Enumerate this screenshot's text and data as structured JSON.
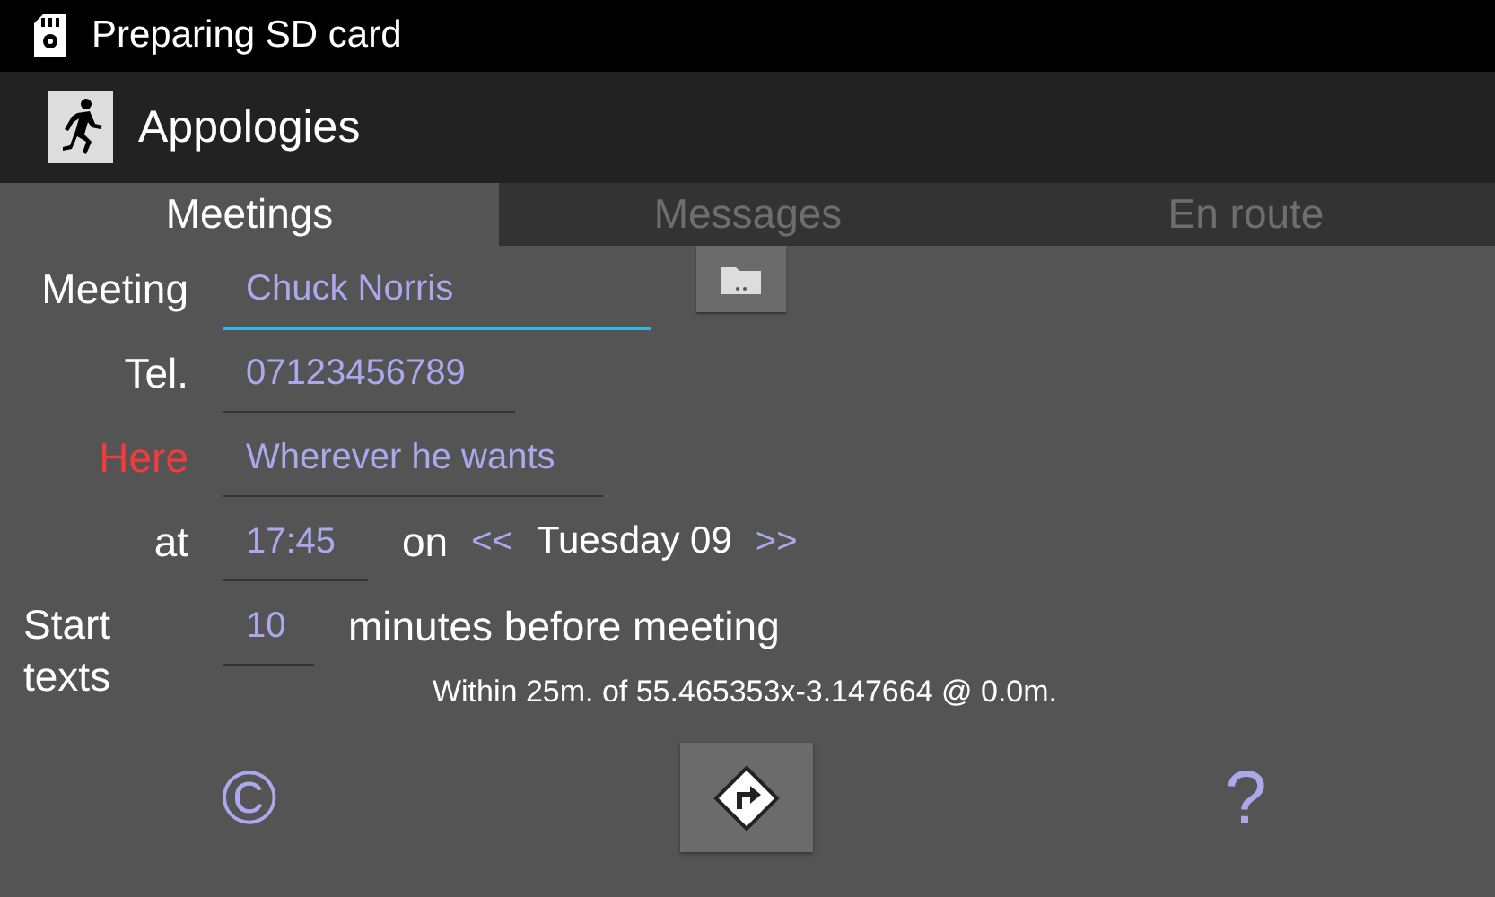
{
  "status_bar": {
    "notification": "Preparing SD card"
  },
  "action_bar": {
    "title": "Appologies"
  },
  "tabs": [
    {
      "label": "Meetings",
      "selected": true
    },
    {
      "label": "Messages",
      "selected": false
    },
    {
      "label": "En route",
      "selected": false
    }
  ],
  "form": {
    "meeting": {
      "label": "Meeting",
      "value": "Chuck Norris",
      "focused": true
    },
    "tel": {
      "label": "Tel.",
      "value": "07123456789",
      "focused": false
    },
    "place": {
      "label": "Here",
      "value": "Wherever he wants",
      "focused": false,
      "highlighted": true
    },
    "time": {
      "label": "at",
      "value": "17:45",
      "focused": false,
      "on_label": "on",
      "prev": "<<",
      "date": "Tuesday 09",
      "next": ">>"
    },
    "start": {
      "label": "Start texts",
      "value": "10",
      "focused": false,
      "suffix": "minutes before meeting"
    },
    "location": "Within 25m. of 55.465353x-3.147664 @ 0.0m."
  },
  "bottom": {
    "left": "©",
    "right": "?"
  }
}
